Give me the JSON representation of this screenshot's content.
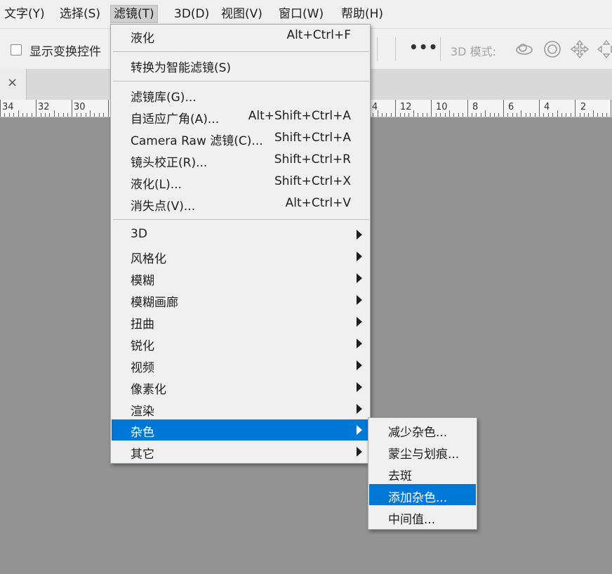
{
  "menubar": {
    "items": [
      {
        "label": "文字(Y)"
      },
      {
        "label": "选择(S)"
      },
      {
        "label": "滤镜(T)"
      },
      {
        "label": "3D(D)"
      },
      {
        "label": "视图(V)"
      },
      {
        "label": "窗口(W)"
      },
      {
        "label": "帮助(H)"
      }
    ]
  },
  "options_bar": {
    "show_transform_label": "显示变换控件",
    "more_glyph": "•••",
    "mode_3d_label": "3D 模式:",
    "icons": [
      "orbit-icon",
      "roll-icon",
      "pan-icon",
      "slide-icon"
    ]
  },
  "tab": {
    "close_glyph": "×"
  },
  "ruler": {
    "numbers": [
      "34",
      "32",
      "30",
      "4",
      "12",
      "10",
      "8",
      "6",
      "4",
      "2"
    ]
  },
  "filter_menu": {
    "items": [
      {
        "label": "液化",
        "shortcut": "Alt+Ctrl+F"
      },
      {
        "label": "转换为智能滤镜(S)",
        "shortcut": ""
      },
      {
        "label": "滤镜库(G)...",
        "shortcut": ""
      },
      {
        "label": "自适应广角(A)...",
        "shortcut": "Alt+Shift+Ctrl+A"
      },
      {
        "label": "Camera Raw 滤镜(C)...",
        "shortcut": "Shift+Ctrl+A"
      },
      {
        "label": "镜头校正(R)...",
        "shortcut": "Shift+Ctrl+R"
      },
      {
        "label": "液化(L)...",
        "shortcut": "Shift+Ctrl+X"
      },
      {
        "label": "消失点(V)...",
        "shortcut": "Alt+Ctrl+V"
      },
      {
        "label": "3D",
        "submenu": true
      },
      {
        "label": "风格化",
        "submenu": true
      },
      {
        "label": "模糊",
        "submenu": true
      },
      {
        "label": "模糊画廊",
        "submenu": true
      },
      {
        "label": "扭曲",
        "submenu": true
      },
      {
        "label": "锐化",
        "submenu": true
      },
      {
        "label": "视频",
        "submenu": true
      },
      {
        "label": "像素化",
        "submenu": true
      },
      {
        "label": "渲染",
        "submenu": true
      },
      {
        "label": "杂色",
        "submenu": true
      },
      {
        "label": "其它",
        "submenu": true
      }
    ]
  },
  "noise_submenu": {
    "items": [
      {
        "label": "减少杂色..."
      },
      {
        "label": "蒙尘与划痕..."
      },
      {
        "label": "去斑"
      },
      {
        "label": "添加杂色..."
      },
      {
        "label": "中间值..."
      }
    ]
  },
  "colors": {
    "highlight": "#0078d7",
    "canvas": "#939393",
    "menu_bg": "#f0f0f0"
  }
}
